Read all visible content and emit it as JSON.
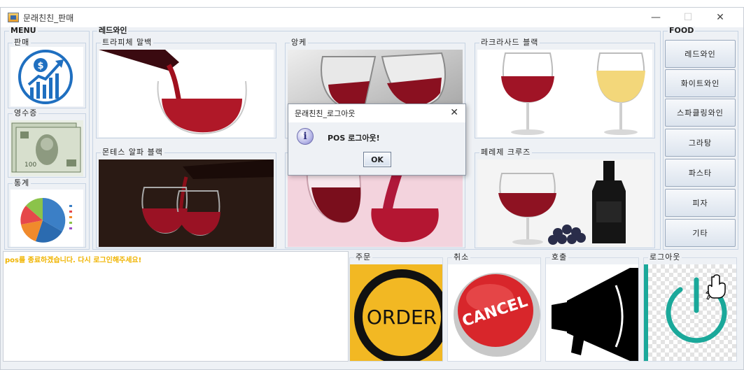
{
  "window": {
    "title": "문래친친_판매",
    "minimize": "—",
    "maximize": "☐",
    "close": "✕"
  },
  "menu": {
    "title": "MENU",
    "items": [
      {
        "label": "판매",
        "icon": "sales-chart-icon"
      },
      {
        "label": "영수증",
        "icon": "money-bills-icon"
      },
      {
        "label": "통계",
        "icon": "pie-chart-icon"
      }
    ]
  },
  "wine_panel": {
    "title": "레드와인",
    "cards": [
      {
        "label": "트라피체 말백"
      },
      {
        "label": "앙케"
      },
      {
        "label": "라크라사드 블랙"
      },
      {
        "label": "몬테스 알파 블랙"
      },
      {
        "label": ""
      },
      {
        "label": "페레제 크루즈"
      }
    ]
  },
  "food": {
    "title": "FOOD",
    "buttons": [
      "레드와인",
      "화이트와인",
      "스파클링와인",
      "그라탕",
      "파스타",
      "피자",
      "기타"
    ]
  },
  "log": {
    "message": "pos를 종료하겠습니다. 다시 로그인해주세요!"
  },
  "actions": {
    "order": {
      "label": "주문",
      "image_text": "ORDER"
    },
    "cancel": {
      "label": "취소",
      "image_text": "CANCEL"
    },
    "call": {
      "label": "호출"
    },
    "logout": {
      "label": "로그아웃"
    }
  },
  "dialog": {
    "title": "문래친친_로그아웃",
    "message": "POS 로그아웃!",
    "ok": "OK",
    "close": "✕"
  },
  "colors": {
    "log_text": "#f0b400",
    "order_bg": "#f2b823",
    "cancel_red": "#d8262b",
    "logout_teal": "#1aa89a"
  }
}
